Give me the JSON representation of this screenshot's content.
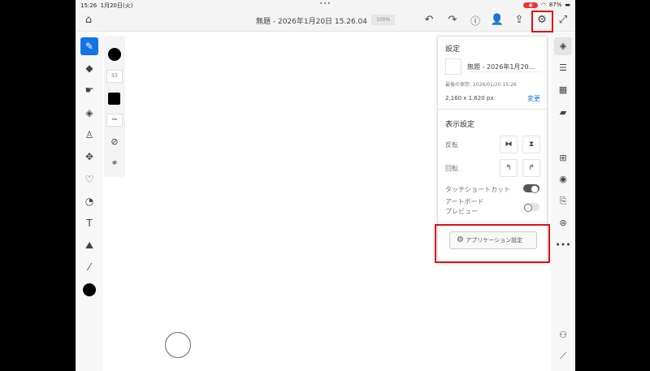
{
  "status": {
    "time": "15:26",
    "date": "1月20日(火)",
    "battery": "87%"
  },
  "toolbar": {
    "doc_title": "無題 - 2026年1月20日 15.26.04",
    "zoom": "100%"
  },
  "brush": {
    "size": "53"
  },
  "settings": {
    "heading": "設定",
    "doc_name": "無題 - 2026年1月20…",
    "last_saved": "最後の保存: 2026/01/20 15:26",
    "dimensions": "2,160 x 1,620 px",
    "change": "変更",
    "display_heading": "表示設定",
    "flip": "反転",
    "rotate": "回転",
    "touch_shortcut": "タッチショートカット",
    "touch_shortcut_on": true,
    "artboard_preview_1": "アートボード",
    "artboard_preview_2": "プレビュー",
    "artboard_preview_on": false,
    "app_settings": "アプリケーション設定"
  },
  "colors": {
    "accent": "#1473e6",
    "highlight": "#e01010"
  }
}
